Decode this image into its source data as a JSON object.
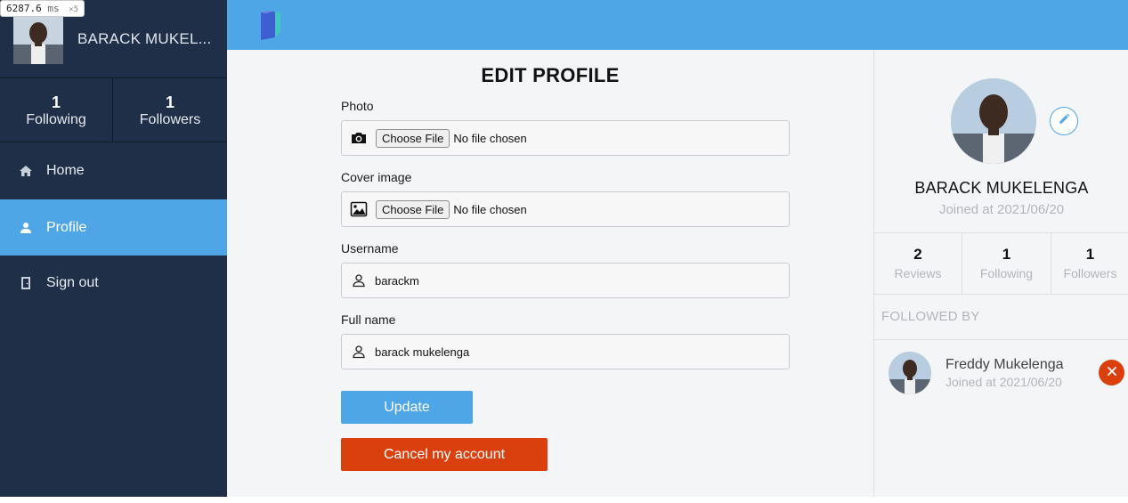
{
  "perf_badge": {
    "value": "6287.6",
    "unit": "ms",
    "multiplier": "×5"
  },
  "colors": {
    "sidebar_bg": "#1f2f47",
    "accent": "#4fa6e6",
    "danger": "#d9400e",
    "panel_bg": "#f4f5f7"
  },
  "sidebar": {
    "user_name": "BARACK MUKEL...",
    "stats": [
      {
        "value": "1",
        "label": "Following"
      },
      {
        "value": "1",
        "label": "Followers"
      }
    ],
    "nav": [
      {
        "label": "Home",
        "icon": "home-icon",
        "active": false
      },
      {
        "label": "Profile",
        "icon": "user-icon",
        "active": true
      },
      {
        "label": "Sign out",
        "icon": "door-icon",
        "active": false
      }
    ]
  },
  "topbar": {
    "logo_icon": "book-logo-icon"
  },
  "edit_profile": {
    "title": "EDIT PROFILE",
    "photo_label": "Photo",
    "photo_button": "Choose File",
    "photo_status": "No file chosen",
    "cover_label": "Cover image",
    "cover_button": "Choose File",
    "cover_status": "No file chosen",
    "username_label": "Username",
    "username_value": "barackm",
    "fullname_label": "Full name",
    "fullname_value": "barack mukelenga",
    "update_button": "Update",
    "cancel_button": "Cancel my account"
  },
  "profile_panel": {
    "name": "BARACK MUKELENGA",
    "joined": "Joined at 2021/06/20",
    "stats": [
      {
        "value": "2",
        "label": "Reviews"
      },
      {
        "value": "1",
        "label": "Following"
      },
      {
        "value": "1",
        "label": "Followers"
      }
    ],
    "followed_by_heading": "FOLLOWED BY",
    "followers": [
      {
        "name": "Freddy Mukelenga",
        "joined": "Joined at 2021/06/20"
      }
    ]
  }
}
